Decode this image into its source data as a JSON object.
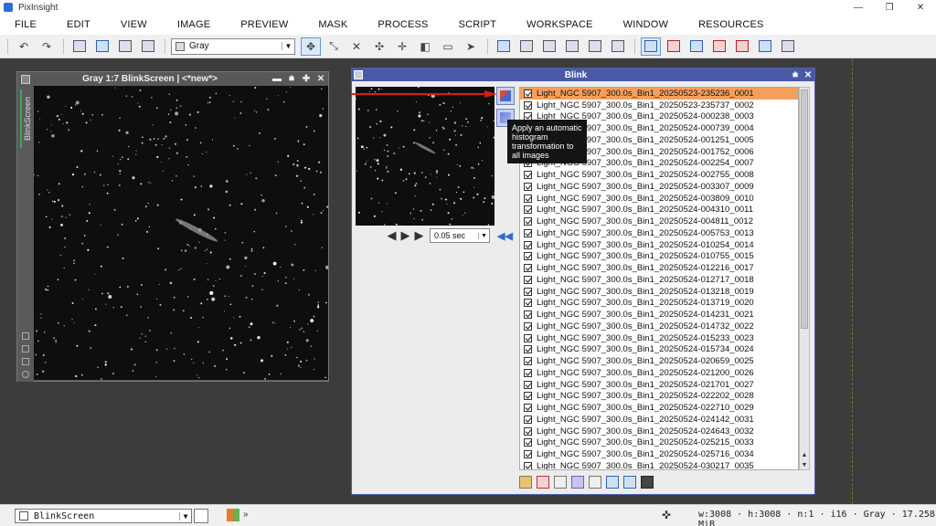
{
  "app": {
    "title": "PixInsight"
  },
  "window_controls": {
    "minimize": "—",
    "restore": "❐",
    "close": "✕"
  },
  "menu": [
    "FILE",
    "EDIT",
    "VIEW",
    "IMAGE",
    "PREVIEW",
    "MASK",
    "PROCESS",
    "SCRIPT",
    "WORKSPACE",
    "WINDOW",
    "RESOURCES"
  ],
  "toolbar": {
    "colorspace_value": "Gray"
  },
  "image_window": {
    "title": "Gray 1:7 BlinkScreen | <*new*>",
    "side_tab": "BlinkScreen",
    "controls": {
      "min": "▬",
      "shade": "⩧",
      "max": "✚",
      "close": "✕"
    }
  },
  "blink": {
    "title": "Blink",
    "controls": {
      "shade": "⩧",
      "close": "✕"
    },
    "rate_value": "0.05 sec",
    "tooltip": "Apply an automatic histogram transformation to all images",
    "files": [
      "Light_NGC 5907_300.0s_Bin1_20250523-235236_0001",
      "Light_NGC 5907_300.0s_Bin1_20250523-235737_0002",
      "Light_NGC 5907_300.0s_Bin1_20250524-000238_0003",
      "Light_NGC 5907_300.0s_Bin1_20250524-000739_0004",
      "Light_NGC 5907_300.0s_Bin1_20250524-001251_0005",
      "Light_NGC 5907_300.0s_Bin1_20250524-001752_0006",
      "Light_NGC 5907_300.0s_Bin1_20250524-002254_0007",
      "Light_NGC 5907_300.0s_Bin1_20250524-002755_0008",
      "Light_NGC 5907_300.0s_Bin1_20250524-003307_0009",
      "Light_NGC 5907_300.0s_Bin1_20250524-003809_0010",
      "Light_NGC 5907_300.0s_Bin1_20250524-004310_0011",
      "Light_NGC 5907_300.0s_Bin1_20250524-004811_0012",
      "Light_NGC 5907_300.0s_Bin1_20250524-005753_0013",
      "Light_NGC 5907_300.0s_Bin1_20250524-010254_0014",
      "Light_NGC 5907_300.0s_Bin1_20250524-010755_0015",
      "Light_NGC 5907_300.0s_Bin1_20250524-012216_0017",
      "Light_NGC 5907_300.0s_Bin1_20250524-012717_0018",
      "Light_NGC 5907_300.0s_Bin1_20250524-013218_0019",
      "Light_NGC 5907_300.0s_Bin1_20250524-013719_0020",
      "Light_NGC 5907_300.0s_Bin1_20250524-014231_0021",
      "Light_NGC 5907_300.0s_Bin1_20250524-014732_0022",
      "Light_NGC 5907_300.0s_Bin1_20250524-015233_0023",
      "Light_NGC 5907_300.0s_Bin1_20250524-015734_0024",
      "Light_NGC 5907_300.0s_Bin1_20250524-020659_0025",
      "Light_NGC 5907_300.0s_Bin1_20250524-021200_0026",
      "Light_NGC 5907_300.0s_Bin1_20250524-021701_0027",
      "Light_NGC 5907_300.0s_Bin1_20250524-022202_0028",
      "Light_NGC 5907_300.0s_Bin1_20250524-022710_0029",
      "Light_NGC 5907_300.0s_Bin1_20250524-024142_0031",
      "Light_NGC 5907_300.0s_Bin1_20250524-024643_0032",
      "Light_NGC 5907_300.0s_Bin1_20250524-025215_0033",
      "Light_NGC 5907_300.0s_Bin1_20250524-025716_0034",
      "Light_NGC 5907_300.0s_Bin1_20250524-030217_0035"
    ]
  },
  "statusbar": {
    "view_value": "BlinkScreen",
    "more": "»",
    "info": "w:3008 · h:3008 · n:1 · i16 · Gray · 17.258 MiB"
  },
  "colors": {
    "accent": "#4a5aa8",
    "selection": "#f5a05a",
    "arrow": "#e01818"
  }
}
